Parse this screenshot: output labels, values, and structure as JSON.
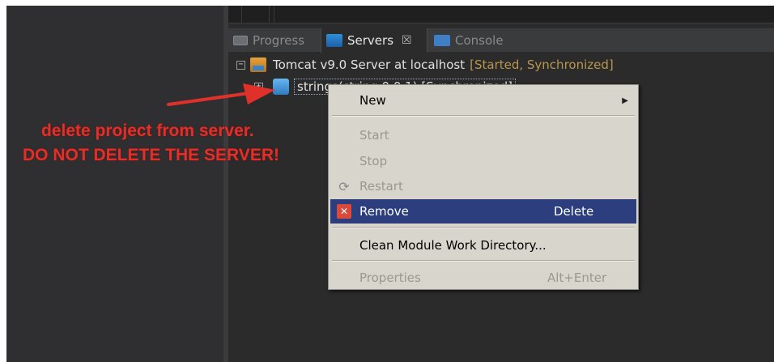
{
  "tabs": [
    {
      "label": "Progress"
    },
    {
      "label": "Servers",
      "close": "☒"
    },
    {
      "label": "Console"
    }
  ],
  "tree": {
    "server": {
      "expander": "−",
      "name": "Tomcat v9.0 Server at localhost",
      "status": "[Started, Synchronized]"
    },
    "module": {
      "expander": "+",
      "label": "strings(string 0.0.1) [Synchronized]"
    }
  },
  "context_menu": {
    "items": [
      {
        "label": "New",
        "submenu": true
      },
      {
        "label": "Start",
        "disabled": true
      },
      {
        "label": "Stop",
        "disabled": true
      },
      {
        "label": "Restart",
        "disabled": true
      },
      {
        "label": "Remove",
        "accelerator": "Delete",
        "highlighted": true
      },
      {
        "label": "Clean Module Work Directory..."
      },
      {
        "label": "Properties",
        "accelerator": "Alt+Enter",
        "disabled": true
      }
    ]
  },
  "annotation": {
    "line1": "delete project from server.",
    "line2": "DO NOT DELETE THE SERVER!"
  },
  "colors": {
    "annotation": "#e0302a",
    "menu_highlight": "#2c3e7e",
    "status_text": "#b8964c"
  }
}
